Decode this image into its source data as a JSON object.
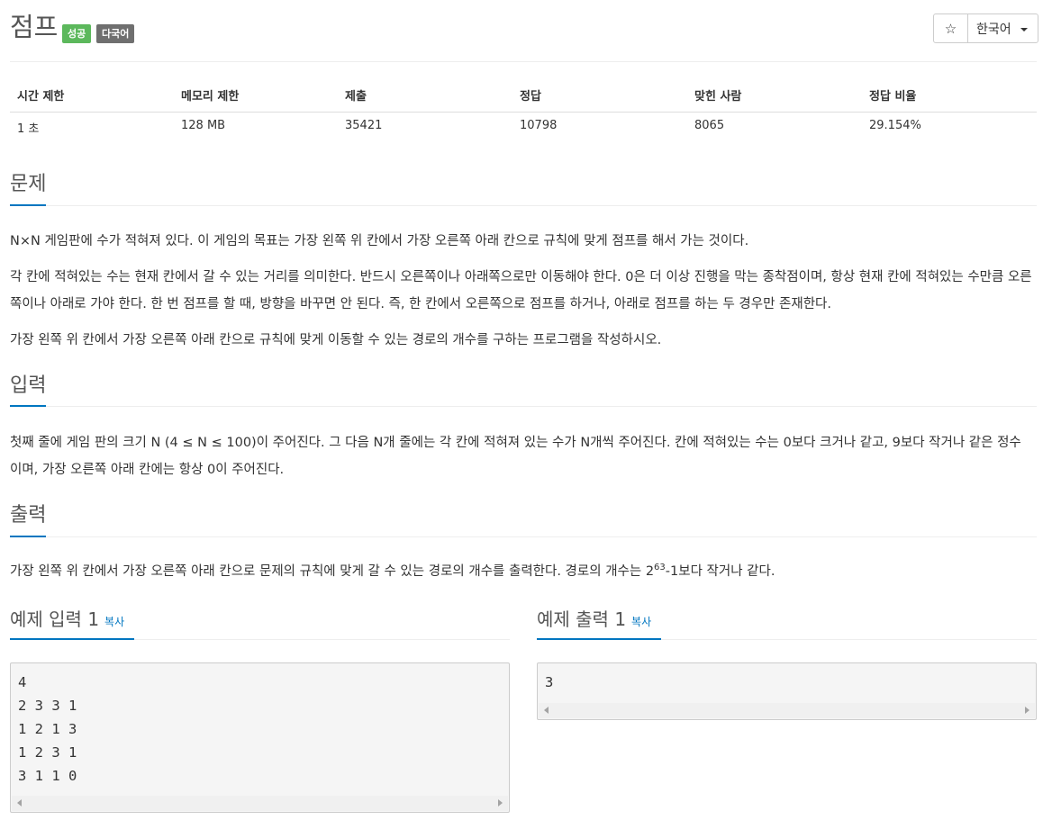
{
  "problem": {
    "title": "점프",
    "badges": {
      "status": "성공",
      "language": "다국어"
    },
    "star_icon": "☆",
    "language_select": "한국어"
  },
  "stats": {
    "headers": [
      "시간 제한",
      "메모리 제한",
      "제출",
      "정답",
      "맞힌 사람",
      "정답 비율"
    ],
    "values": [
      "1 초",
      "128 MB",
      "35421",
      "10798",
      "8065",
      "29.154%"
    ]
  },
  "sections": {
    "problem": {
      "heading": "문제",
      "paragraphs": [
        "N×N 게임판에 수가 적혀져 있다. 이 게임의 목표는 가장 왼쪽 위 칸에서 가장 오른쪽 아래 칸으로 규칙에 맞게 점프를 해서 가는 것이다.",
        "각 칸에 적혀있는 수는 현재 칸에서 갈 수 있는 거리를 의미한다. 반드시 오른쪽이나 아래쪽으로만 이동해야 한다. 0은 더 이상 진행을 막는 종착점이며, 항상 현재 칸에 적혀있는 수만큼 오른쪽이나 아래로 가야 한다. 한 번 점프를 할 때, 방향을 바꾸면 안 된다. 즉, 한 칸에서 오른쪽으로 점프를 하거나, 아래로 점프를 하는 두 경우만 존재한다.",
        "가장 왼쪽 위 칸에서 가장 오른쪽 아래 칸으로 규칙에 맞게 이동할 수 있는 경로의 개수를 구하는 프로그램을 작성하시오."
      ]
    },
    "input": {
      "heading": "입력",
      "paragraph": "첫째 줄에 게임 판의 크기 N (4 ≤ N ≤ 100)이 주어진다. 그 다음 N개 줄에는 각 칸에 적혀져 있는 수가 N개씩 주어진다. 칸에 적혀있는 수는 0보다 크거나 같고, 9보다 작거나 같은 정수이며, 가장 오른쪽 아래 칸에는 항상 0이 주어진다."
    },
    "output": {
      "heading": "출력",
      "text_before": "가장 왼쪽 위 칸에서 가장 오른쪽 아래 칸으로 문제의 규칙에 맞게 갈 수 있는 경로의 개수를 출력한다. 경로의 개수는 2",
      "superscript": "63",
      "text_after": "-1보다 작거나 같다."
    }
  },
  "samples": {
    "input": {
      "title": "예제 입력 1",
      "copy_label": "복사",
      "content": "4\n2 3 3 1\n1 2 1 3\n1 2 3 1\n3 1 1 0"
    },
    "output": {
      "title": "예제 출력 1",
      "copy_label": "복사",
      "content": "3"
    }
  },
  "colors": {
    "success_badge": "#5cb85c",
    "language_badge": "#6f6f6f",
    "accent": "#0076c0"
  }
}
